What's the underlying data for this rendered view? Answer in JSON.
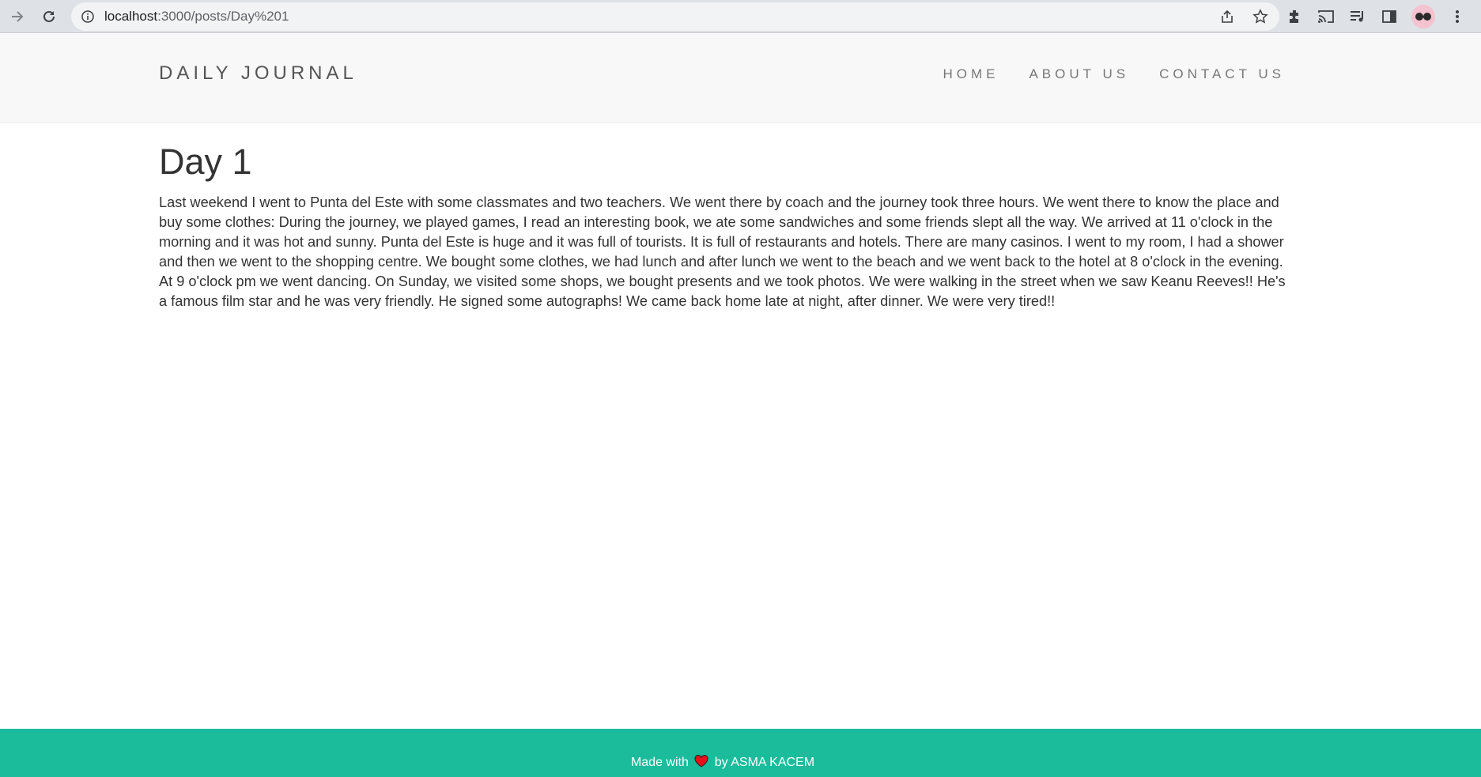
{
  "browser": {
    "url_host": "localhost",
    "url_path": ":3000/posts/Day%201"
  },
  "header": {
    "brand": "DAILY JOURNAL",
    "nav": [
      "HOME",
      "ABOUT US",
      "CONTACT US"
    ]
  },
  "post": {
    "title": "Day 1",
    "body": "Last weekend I went to Punta del Este with some classmates and two teachers. We went there by coach and the journey took three hours. We went there to know the place and buy some clothes: During the journey, we played games, I read an interesting book, we ate some sandwiches and some friends slept all the way. We arrived at 11 o'clock in the morning and it was hot and sunny. Punta del Este is huge and it was full of tourists. It is full of restaurants and hotels. There are many casinos. I went to my room, I had a shower and then we went to the shopping centre. We bought some clothes, we had lunch and after lunch we went to the beach and we went back to the hotel at 8 o'clock in the evening. At 9 o'clock pm we went dancing. On Sunday, we visited some shops, we bought presents and we took photos. We were walking in the street when we saw Keanu Reeves!! He's a famous film star and he was very friendly. He signed some autographs! We came back home late at night, after dinner. We were very tired!!"
  },
  "footer": {
    "made_with": "Made with",
    "by": "by ASMA KACEM"
  },
  "colors": {
    "footer_bg": "#1abc9c",
    "header_bg": "#f8f8f8",
    "heart": "#e8101a"
  }
}
